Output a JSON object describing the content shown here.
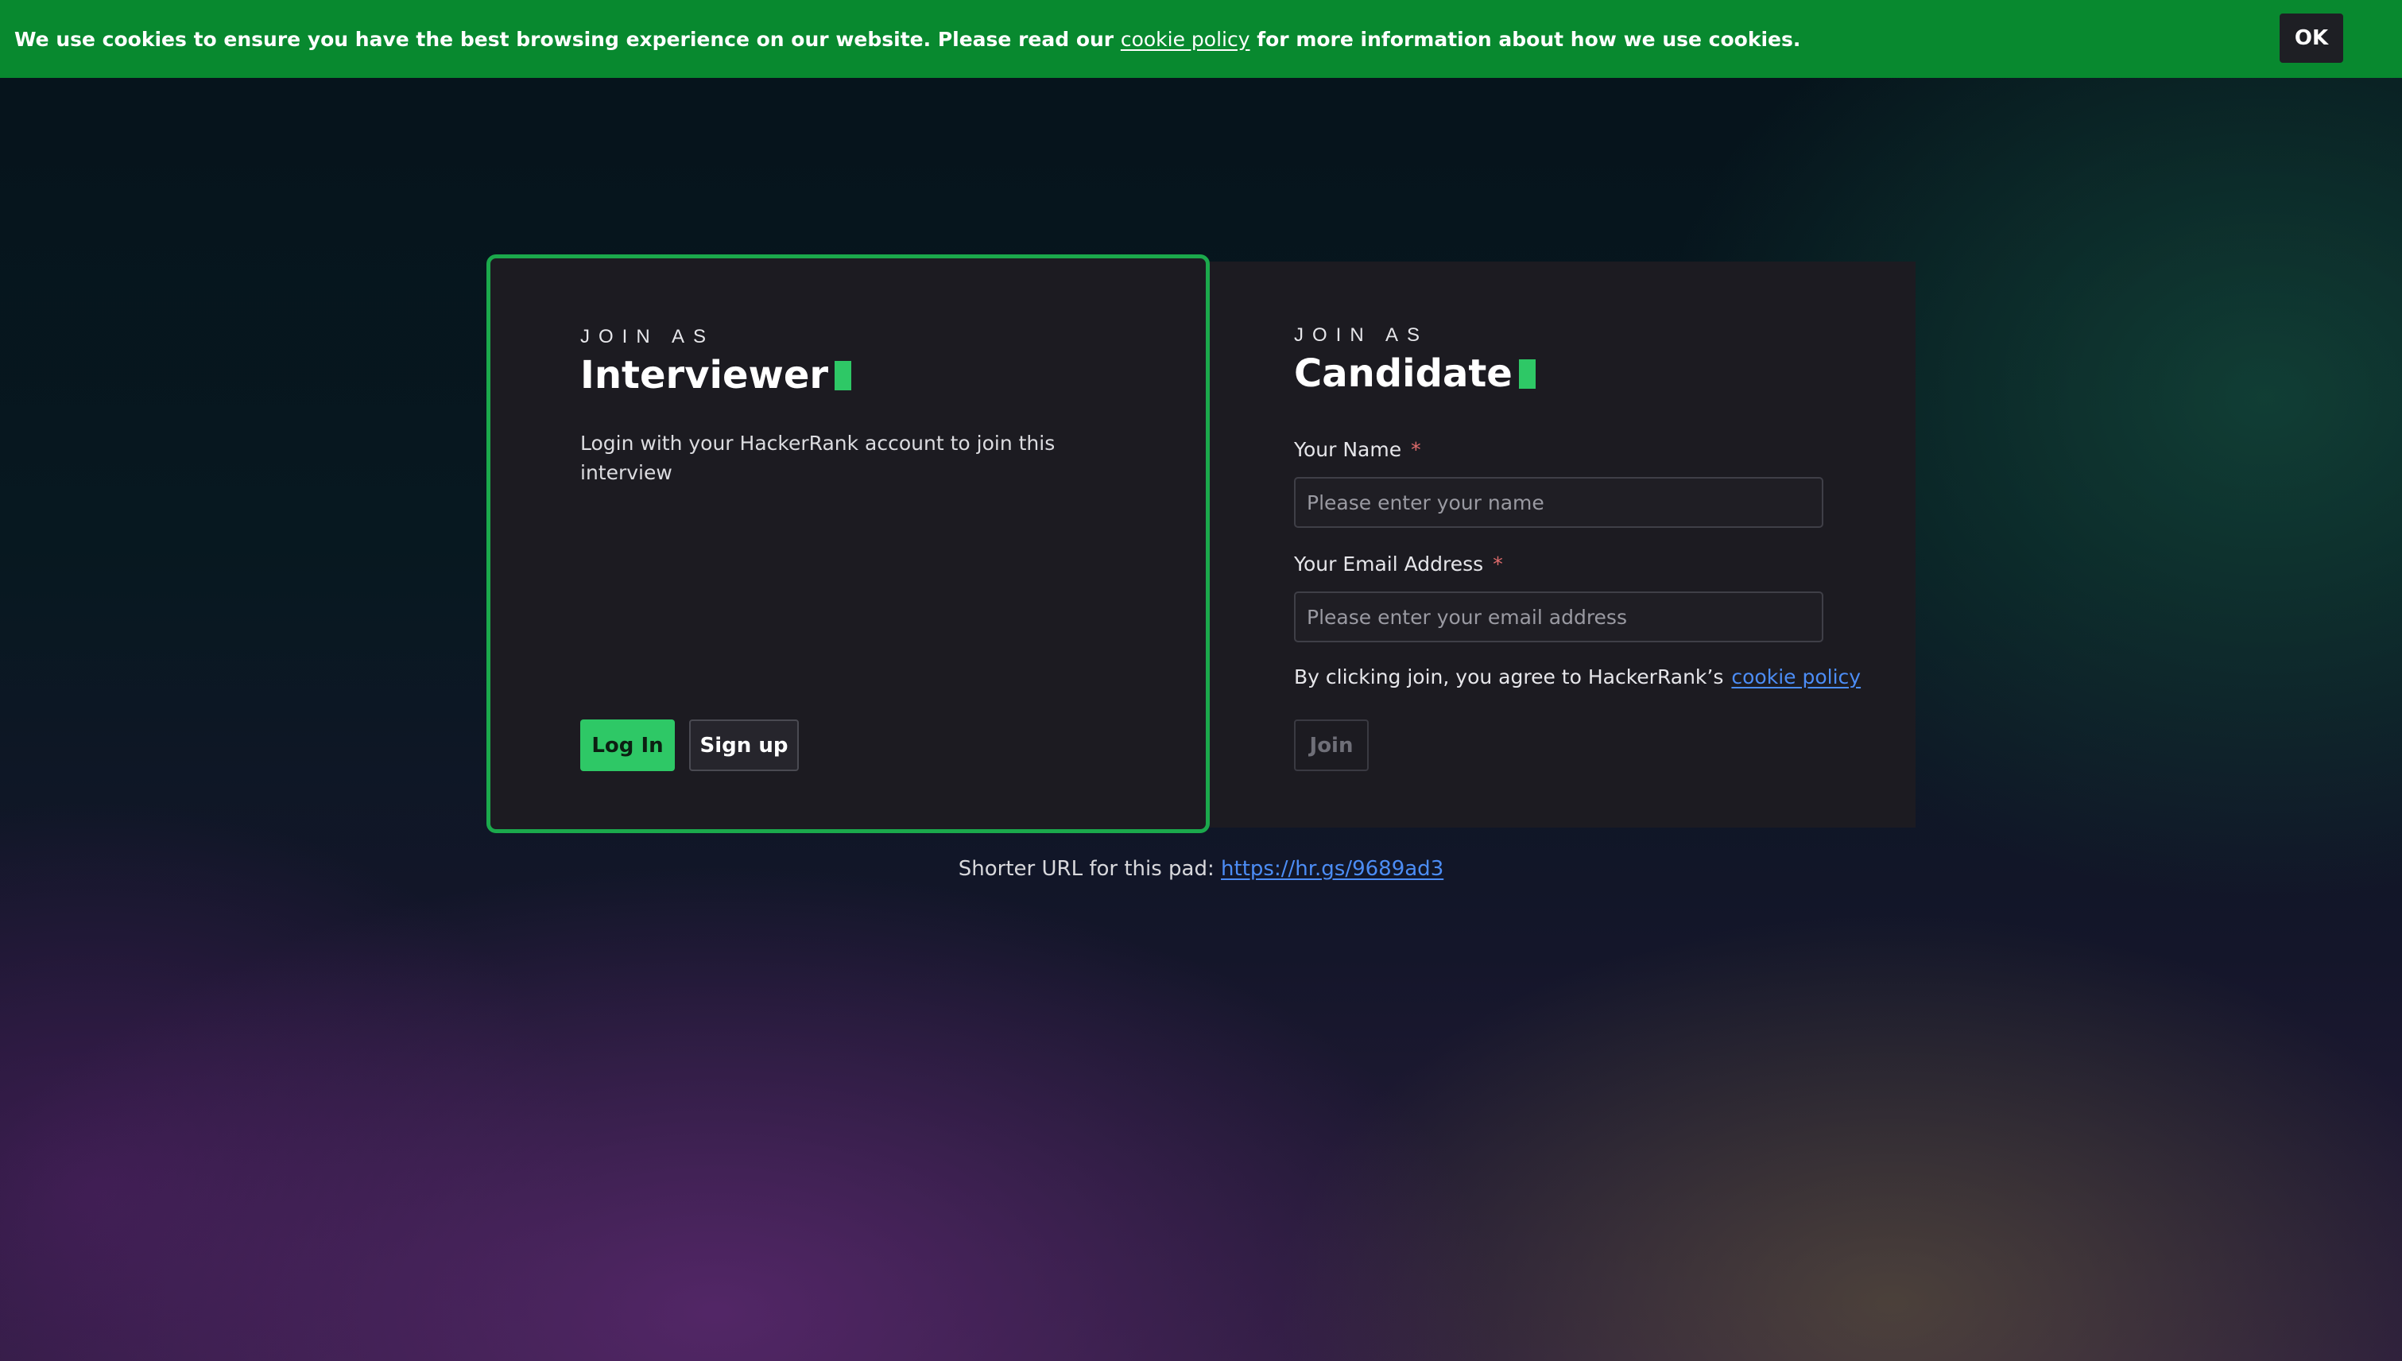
{
  "cookie_banner": {
    "text_before": "We use cookies to ensure you have the best browsing experience on our website. Please read our ",
    "link_text": "cookie policy",
    "text_after": " for more information about how we use cookies.",
    "ok_label": "OK"
  },
  "interviewer": {
    "eyebrow": "JOIN AS",
    "title": "Interviewer",
    "description": "Login with your HackerRank account to join this interview",
    "login_label": "Log In",
    "signup_label": "Sign up"
  },
  "candidate": {
    "eyebrow": "JOIN AS",
    "title": "Candidate",
    "name_label": "Your Name",
    "name_placeholder": "Please enter your name",
    "name_value": "",
    "email_label": "Your Email Address",
    "email_placeholder": "Please enter your email address",
    "email_value": "",
    "required_marker": "*",
    "agree_text": "By clicking join, you agree to HackerRank’s",
    "agree_link": "cookie policy",
    "join_label": "Join"
  },
  "footer": {
    "short_url_label": "Shorter URL for this pad:",
    "short_url": "https://hr.gs/9689ad3"
  },
  "colors": {
    "accent_green": "#2ec866",
    "banner_green": "#08892f",
    "panel_bg": "#1c1b21",
    "link_blue": "#4c8df6",
    "required_red": "#e06c6c"
  }
}
